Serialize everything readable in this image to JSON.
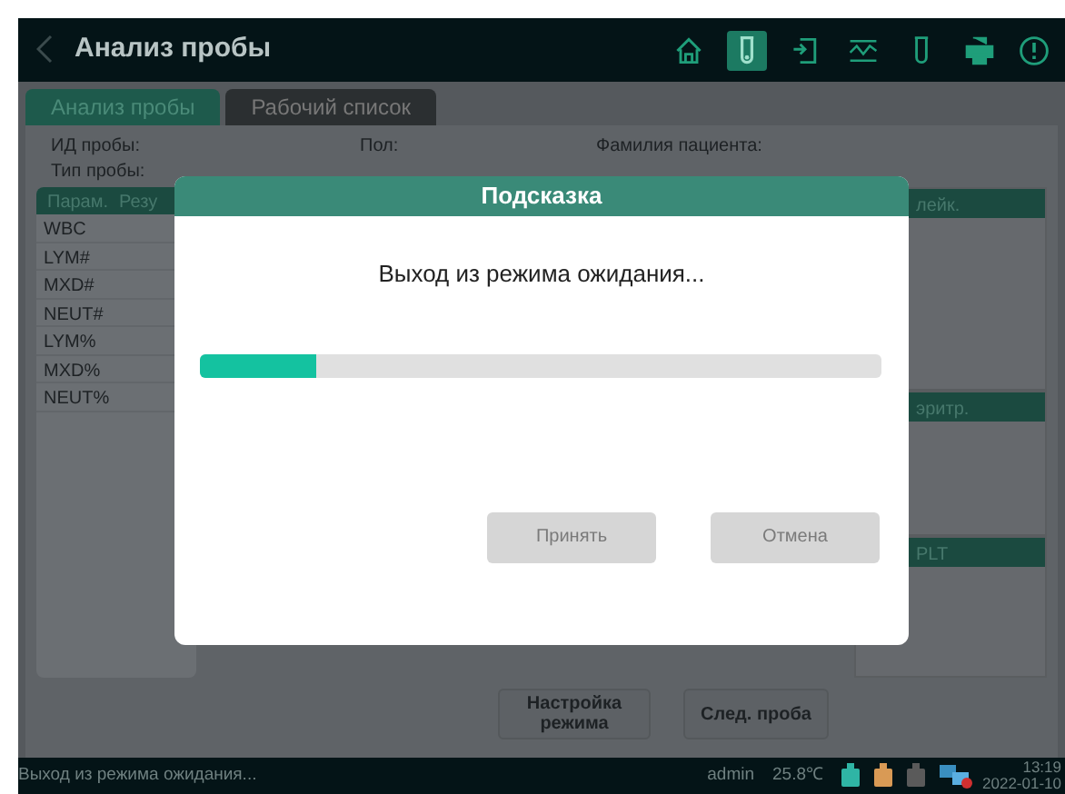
{
  "app_bar": {
    "title": "Анализ пробы",
    "toolbar": [
      {
        "kind": "home",
        "selected": false
      },
      {
        "kind": "tube",
        "selected": true
      },
      {
        "kind": "export",
        "selected": false
      },
      {
        "kind": "chart",
        "selected": false
      },
      {
        "kind": "reagent",
        "selected": false
      },
      {
        "kind": "print",
        "selected": false
      },
      {
        "kind": "alert",
        "selected": false
      }
    ]
  },
  "tabs": [
    {
      "label": "Анализ пробы",
      "selected": true
    },
    {
      "label": "Рабочий список",
      "selected": false
    }
  ],
  "fields": [
    "ИД пробы:",
    "Пол:",
    "Фамилия пациента:",
    "Тип пробы:"
  ],
  "results_table": {
    "columns": [
      "Парам.",
      "Резу"
    ],
    "rows": [
      "WBC",
      "LYM#",
      "MXD#",
      "NEUT#",
      "LYM%",
      "MXD%",
      "NEUT%"
    ]
  },
  "right_panels": [
    "лейк.",
    "эритр.",
    "PLT"
  ],
  "buttons": [
    "Настройка режима",
    "След. проба"
  ],
  "dialog": {
    "title": "Подсказка",
    "message": "Выход из режима ожидания...",
    "progress": {
      "level": 0.17
    },
    "buttons": [
      "Принять",
      "Отмена"
    ]
  },
  "status_bar": {
    "message": "Выход из режима ожидания...",
    "user": "admin",
    "temperature": "25.8℃",
    "reagents": [
      {
        "color": "#2fb5a5"
      },
      {
        "color": "#d99a55"
      },
      {
        "color": "#5a5a5a"
      }
    ],
    "time": "13:19",
    "date": "2022-01-10"
  }
}
